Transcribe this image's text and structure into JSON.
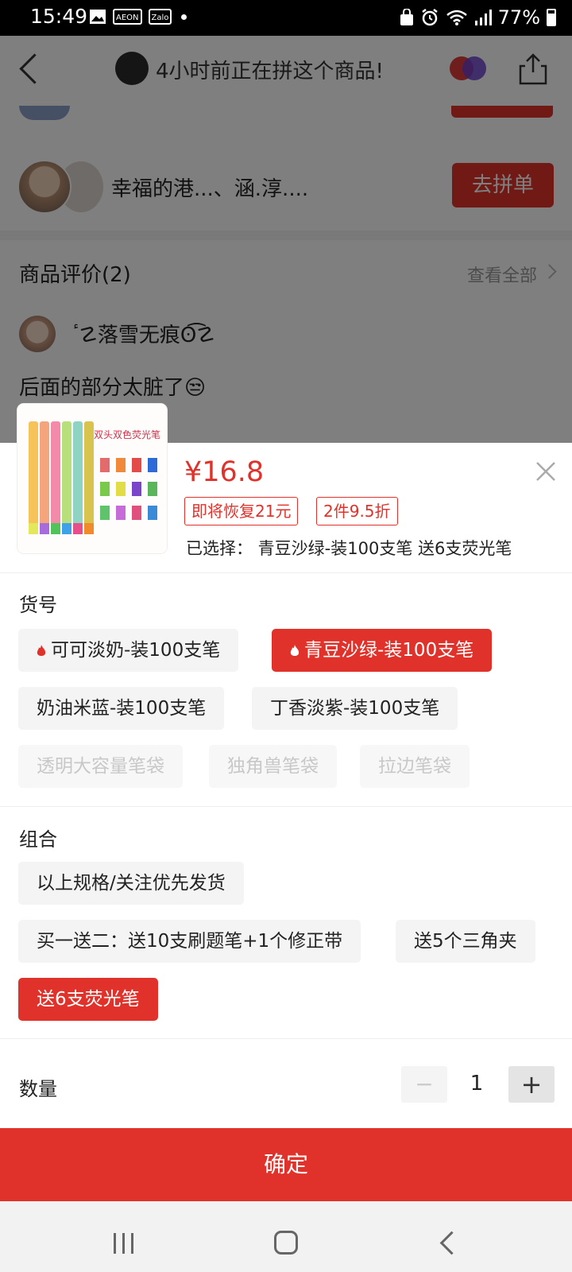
{
  "status_bar": {
    "time": "15:49",
    "battery": "77%",
    "notif_icons": [
      "AEON",
      "Zalo"
    ]
  },
  "background_page": {
    "header_title": "4小时前正在拼这个商品!",
    "group_names": "幸福的港...、涵.淳....",
    "join_button": "去拼单",
    "reviews_title": "商品评价(2)",
    "view_all": "查看全部",
    "reviewer_name": "ٴ☡落雪无痕ʘ͡☡",
    "review_text": "后面的部分太脏了😒"
  },
  "product": {
    "image_caption": "双头双色荧光笔",
    "price": "¥16.8",
    "tags": [
      "即将恢复21元",
      "2件9.5折"
    ],
    "selected": "已选择：  青豆沙绿-装100支笔 送6支荧光笔"
  },
  "sku_section": {
    "title": "货号",
    "options": [
      {
        "label": "可可淡奶-装100支笔",
        "state": "hot"
      },
      {
        "label": "青豆沙绿-装100支笔",
        "state": "selected"
      },
      {
        "label": "奶油米蓝-装100支笔",
        "state": "normal"
      },
      {
        "label": "丁香淡紫-装100支笔",
        "state": "normal"
      },
      {
        "label": "透明大容量笔袋",
        "state": "disabled"
      },
      {
        "label": "独角兽笔袋",
        "state": "disabled"
      },
      {
        "label": "拉边笔袋",
        "state": "disabled"
      }
    ]
  },
  "combo_section": {
    "title": "组合",
    "options": [
      {
        "label": "以上规格/关注优先发货",
        "state": "normal"
      },
      {
        "label": "买一送二：送10支刷题笔+1个修正带",
        "state": "normal"
      },
      {
        "label": "送5个三角夹",
        "state": "normal"
      },
      {
        "label": "送6支荧光笔",
        "state": "selected"
      }
    ]
  },
  "quantity": {
    "label": "数量",
    "value": "1",
    "minus": "−",
    "plus": "+"
  },
  "confirm_button": "确定",
  "colors": {
    "accent": "#e0322a",
    "option_bg": "#f4f4f4",
    "disabled_text": "#c8c8c8"
  }
}
